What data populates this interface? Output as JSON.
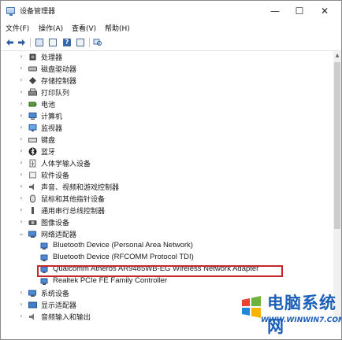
{
  "window": {
    "title": "设备管理器"
  },
  "controls": {
    "minimize": "—",
    "maximize": "☐",
    "close": "✕"
  },
  "menu": [
    "文件(F)",
    "操作(A)",
    "查看(V)",
    "帮助(H)"
  ],
  "toolbar": {
    "help": "?"
  },
  "tree": [
    {
      "label": "处理器",
      "icon": "processor-icon",
      "state": "collapsed"
    },
    {
      "label": "磁盘驱动器",
      "icon": "disk-drive-icon",
      "state": "collapsed"
    },
    {
      "label": "存储控制器",
      "icon": "storage-controller-icon",
      "state": "collapsed"
    },
    {
      "label": "打印队列",
      "icon": "printer-icon",
      "state": "collapsed"
    },
    {
      "label": "电池",
      "icon": "battery-icon",
      "state": "collapsed"
    },
    {
      "label": "计算机",
      "icon": "computer-icon",
      "state": "collapsed"
    },
    {
      "label": "监视器",
      "icon": "monitor-icon",
      "state": "collapsed"
    },
    {
      "label": "键盘",
      "icon": "keyboard-icon",
      "state": "collapsed"
    },
    {
      "label": "蓝牙",
      "icon": "bluetooth-icon",
      "state": "collapsed"
    },
    {
      "label": "人体学输入设备",
      "icon": "hid-icon",
      "state": "collapsed"
    },
    {
      "label": "软件设备",
      "icon": "software-device-icon",
      "state": "collapsed"
    },
    {
      "label": "声音、视频和游戏控制器",
      "icon": "speaker-icon",
      "state": "collapsed"
    },
    {
      "label": "鼠标和其他指针设备",
      "icon": "mouse-icon",
      "state": "collapsed"
    },
    {
      "label": "通用串行总线控制器",
      "icon": "usb-icon",
      "state": "collapsed"
    },
    {
      "label": "图像设备",
      "icon": "camera-icon",
      "state": "collapsed"
    },
    {
      "label": "网络适配器",
      "icon": "network-adapter-icon",
      "state": "expanded",
      "children": [
        {
          "label": "Bluetooth Device (Personal Area Network)"
        },
        {
          "label": "Bluetooth Device (RFCOMM Protocol TDI)"
        },
        {
          "label": "Qualcomm Atheros AR9485WB-EG Wireless Network Adapter",
          "highlighted": true
        },
        {
          "label": "Realtek PCIe FE Family Controller"
        }
      ]
    },
    {
      "label": "系统设备",
      "icon": "system-device-icon",
      "state": "collapsed"
    },
    {
      "label": "显示适配器",
      "icon": "display-adapter-icon",
      "state": "collapsed"
    },
    {
      "label": "音频输入和输出",
      "icon": "audio-io-icon",
      "state": "collapsed"
    }
  ],
  "watermark": {
    "brand": "电脑系统网",
    "url": "WWW.WINWIN7.COM"
  },
  "colors": {
    "highlight_border": "#c8262d",
    "accent": "#1c5fb8"
  }
}
